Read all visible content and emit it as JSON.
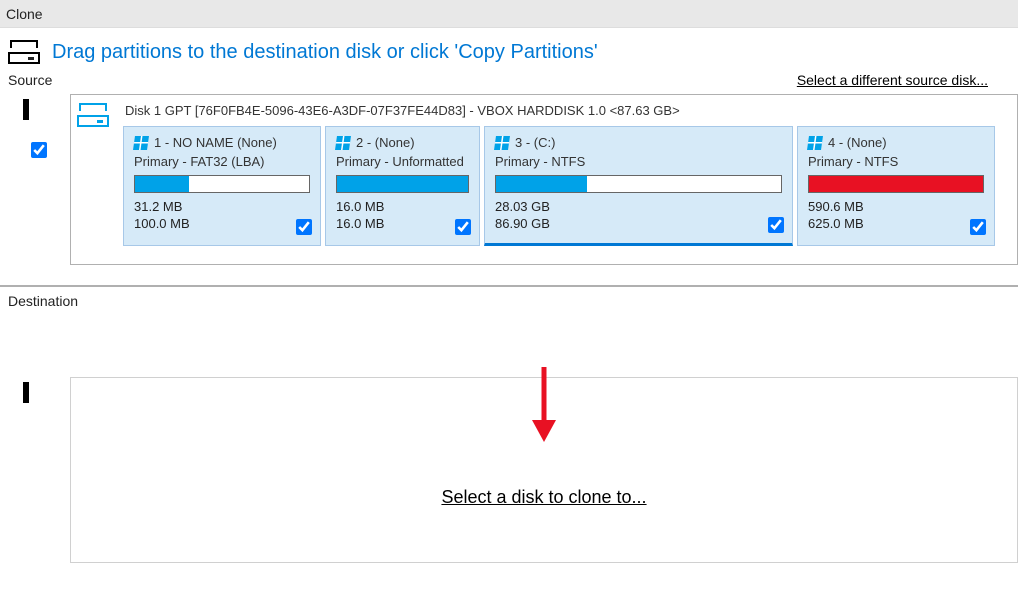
{
  "title": "Clone",
  "instruction": "Drag partitions to the destination disk or click 'Copy Partitions'",
  "source": {
    "label": "Source",
    "different_disk_link": "Select a different source disk...",
    "disk_summary": "Disk 1 GPT [76F0FB4E-5096-43E6-A3DF-07F37FE44D83] - VBOX HARDDISK 1.0  <87.63 GB>",
    "partitions": [
      {
        "title": "1 - NO NAME (None)",
        "subtitle": "Primary - FAT32 (LBA)",
        "used": "31.2 MB",
        "total": "100.0 MB",
        "fill_pct": 31,
        "fill_color": "blue"
      },
      {
        "title": "2 -  (None)",
        "subtitle": "Primary - Unformatted",
        "used": "16.0 MB",
        "total": "16.0 MB",
        "fill_pct": 100,
        "fill_color": "blue"
      },
      {
        "title": "3 -  (C:)",
        "subtitle": "Primary - NTFS",
        "used": "28.03 GB",
        "total": "86.90 GB",
        "fill_pct": 32,
        "fill_color": "blue"
      },
      {
        "title": "4 -  (None)",
        "subtitle": "Primary - NTFS",
        "used": "590.6 MB",
        "total": "625.0 MB",
        "fill_pct": 100,
        "fill_color": "red"
      }
    ]
  },
  "destination": {
    "label": "Destination",
    "select_link": "Select a disk to clone to..."
  }
}
